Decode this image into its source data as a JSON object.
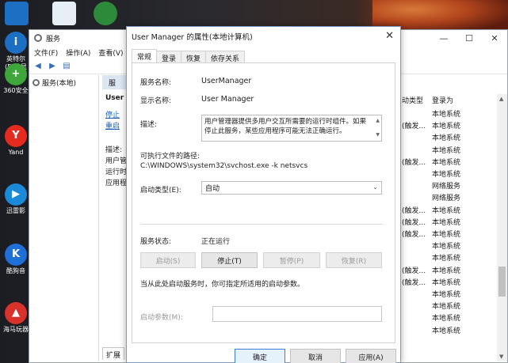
{
  "desktop": {
    "icons": [
      {
        "label": "英特尔(R)芯显卡",
        "color": "#1c6fc2",
        "glyph": "i"
      },
      {
        "label": "360安全",
        "color": "#3ea63a",
        "glyph": "+"
      },
      {
        "label": "Yand",
        "color": "#e52a1f",
        "glyph": "Y"
      },
      {
        "label": "迅雷影",
        "color": "#1b8ad8",
        "glyph": "▶"
      },
      {
        "label": "酷狗音",
        "color": "#1f6fd9",
        "glyph": "K"
      },
      {
        "label": "海马玩器",
        "color": "#d8322a",
        "glyph": "▲"
      }
    ]
  },
  "services_window": {
    "title": "服务",
    "menu": [
      "文件(F)",
      "操作(A)",
      "查看(V)"
    ],
    "tree_item": "服务(本地)",
    "mid_header": "服",
    "mid_title": "User",
    "mid_links": [
      "停止",
      "重启"
    ],
    "mid_text": [
      "描述:",
      "用户管",
      "运行时",
      "应用程"
    ],
    "extended_tab": "扩展",
    "columns": {
      "start_type": "动类型",
      "logon_as": "登录为"
    },
    "rows": [
      {
        "start": "",
        "logon": "本地系统"
      },
      {
        "start": "(触发...",
        "logon": "本地系统"
      },
      {
        "start": "",
        "logon": "本地系统"
      },
      {
        "start": "",
        "logon": "本地系统"
      },
      {
        "start": "(触发...",
        "logon": "本地系统"
      },
      {
        "start": "",
        "logon": "本地系统"
      },
      {
        "start": "",
        "logon": "网络服务"
      },
      {
        "start": "",
        "logon": "网络服务"
      },
      {
        "start": "(触发...",
        "logon": "本地系统"
      },
      {
        "start": "(触发...",
        "logon": "本地系统"
      },
      {
        "start": "(触发...",
        "logon": "本地系统"
      },
      {
        "start": "",
        "logon": "本地系统"
      },
      {
        "start": "",
        "logon": "本地系统"
      },
      {
        "start": "(触发...",
        "logon": "本地系统"
      },
      {
        "start": "(触发...",
        "logon": "本地系统"
      },
      {
        "start": "",
        "logon": "本地系统"
      },
      {
        "start": "",
        "logon": "本地系统"
      },
      {
        "start": "",
        "logon": "本地系统"
      },
      {
        "start": "",
        "logon": "本地系统"
      }
    ]
  },
  "dialog": {
    "title": "User Manager 的属性(本地计算机)",
    "tabs": [
      "常规",
      "登录",
      "恢复",
      "依存关系"
    ],
    "service_name_label": "服务名称:",
    "service_name": "UserManager",
    "display_name_label": "显示名称:",
    "display_name": "User Manager",
    "description_label": "描述:",
    "description": "用户管理器提供多用户交互所需要的运行时组件。如果停止此服务，某些应用程序可能无法正确运行。",
    "path_label": "可执行文件的路径:",
    "path": "C:\\WINDOWS\\system32\\svchost.exe -k netsvcs",
    "startup_type_label": "启动类型(E):",
    "startup_type": "自动",
    "status_label": "服务状态:",
    "status": "正在运行",
    "buttons": {
      "start": "启动(S)",
      "stop": "停止(T)",
      "pause": "暂停(P)",
      "resume": "恢复(R)"
    },
    "hint": "当从此处启动服务时，你可指定所适用的启动参数。",
    "param_label": "启动参数(M):",
    "ok": "确定",
    "cancel": "取消",
    "apply": "应用(A)"
  }
}
